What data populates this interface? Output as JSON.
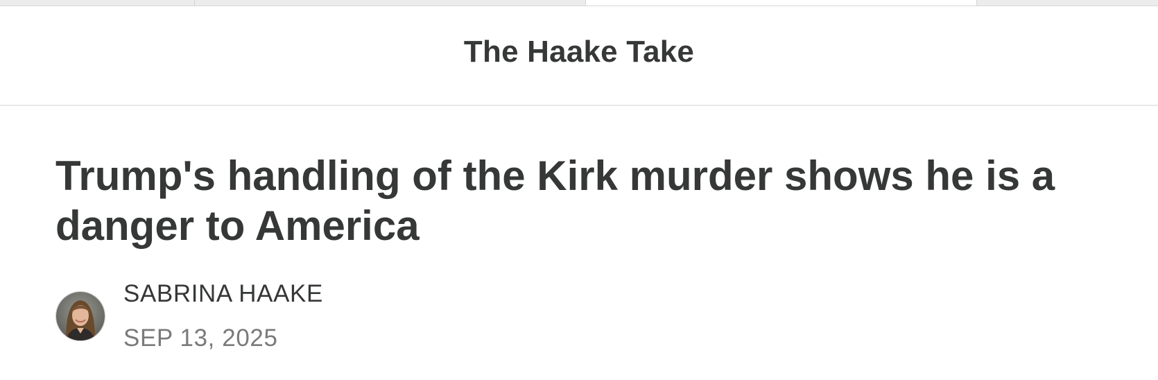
{
  "publication": {
    "title": "The Haake Take"
  },
  "post": {
    "title": "Trump's handling of the Kirk murder shows he is a danger to America",
    "author": "SABRINA HAAKE",
    "date": "SEP 13, 2025"
  },
  "colors": {
    "text": "#363737",
    "muted": "#7a7a7a",
    "divider": "#e8e8e8"
  },
  "icons": {
    "avatar": "author-avatar-photo"
  }
}
